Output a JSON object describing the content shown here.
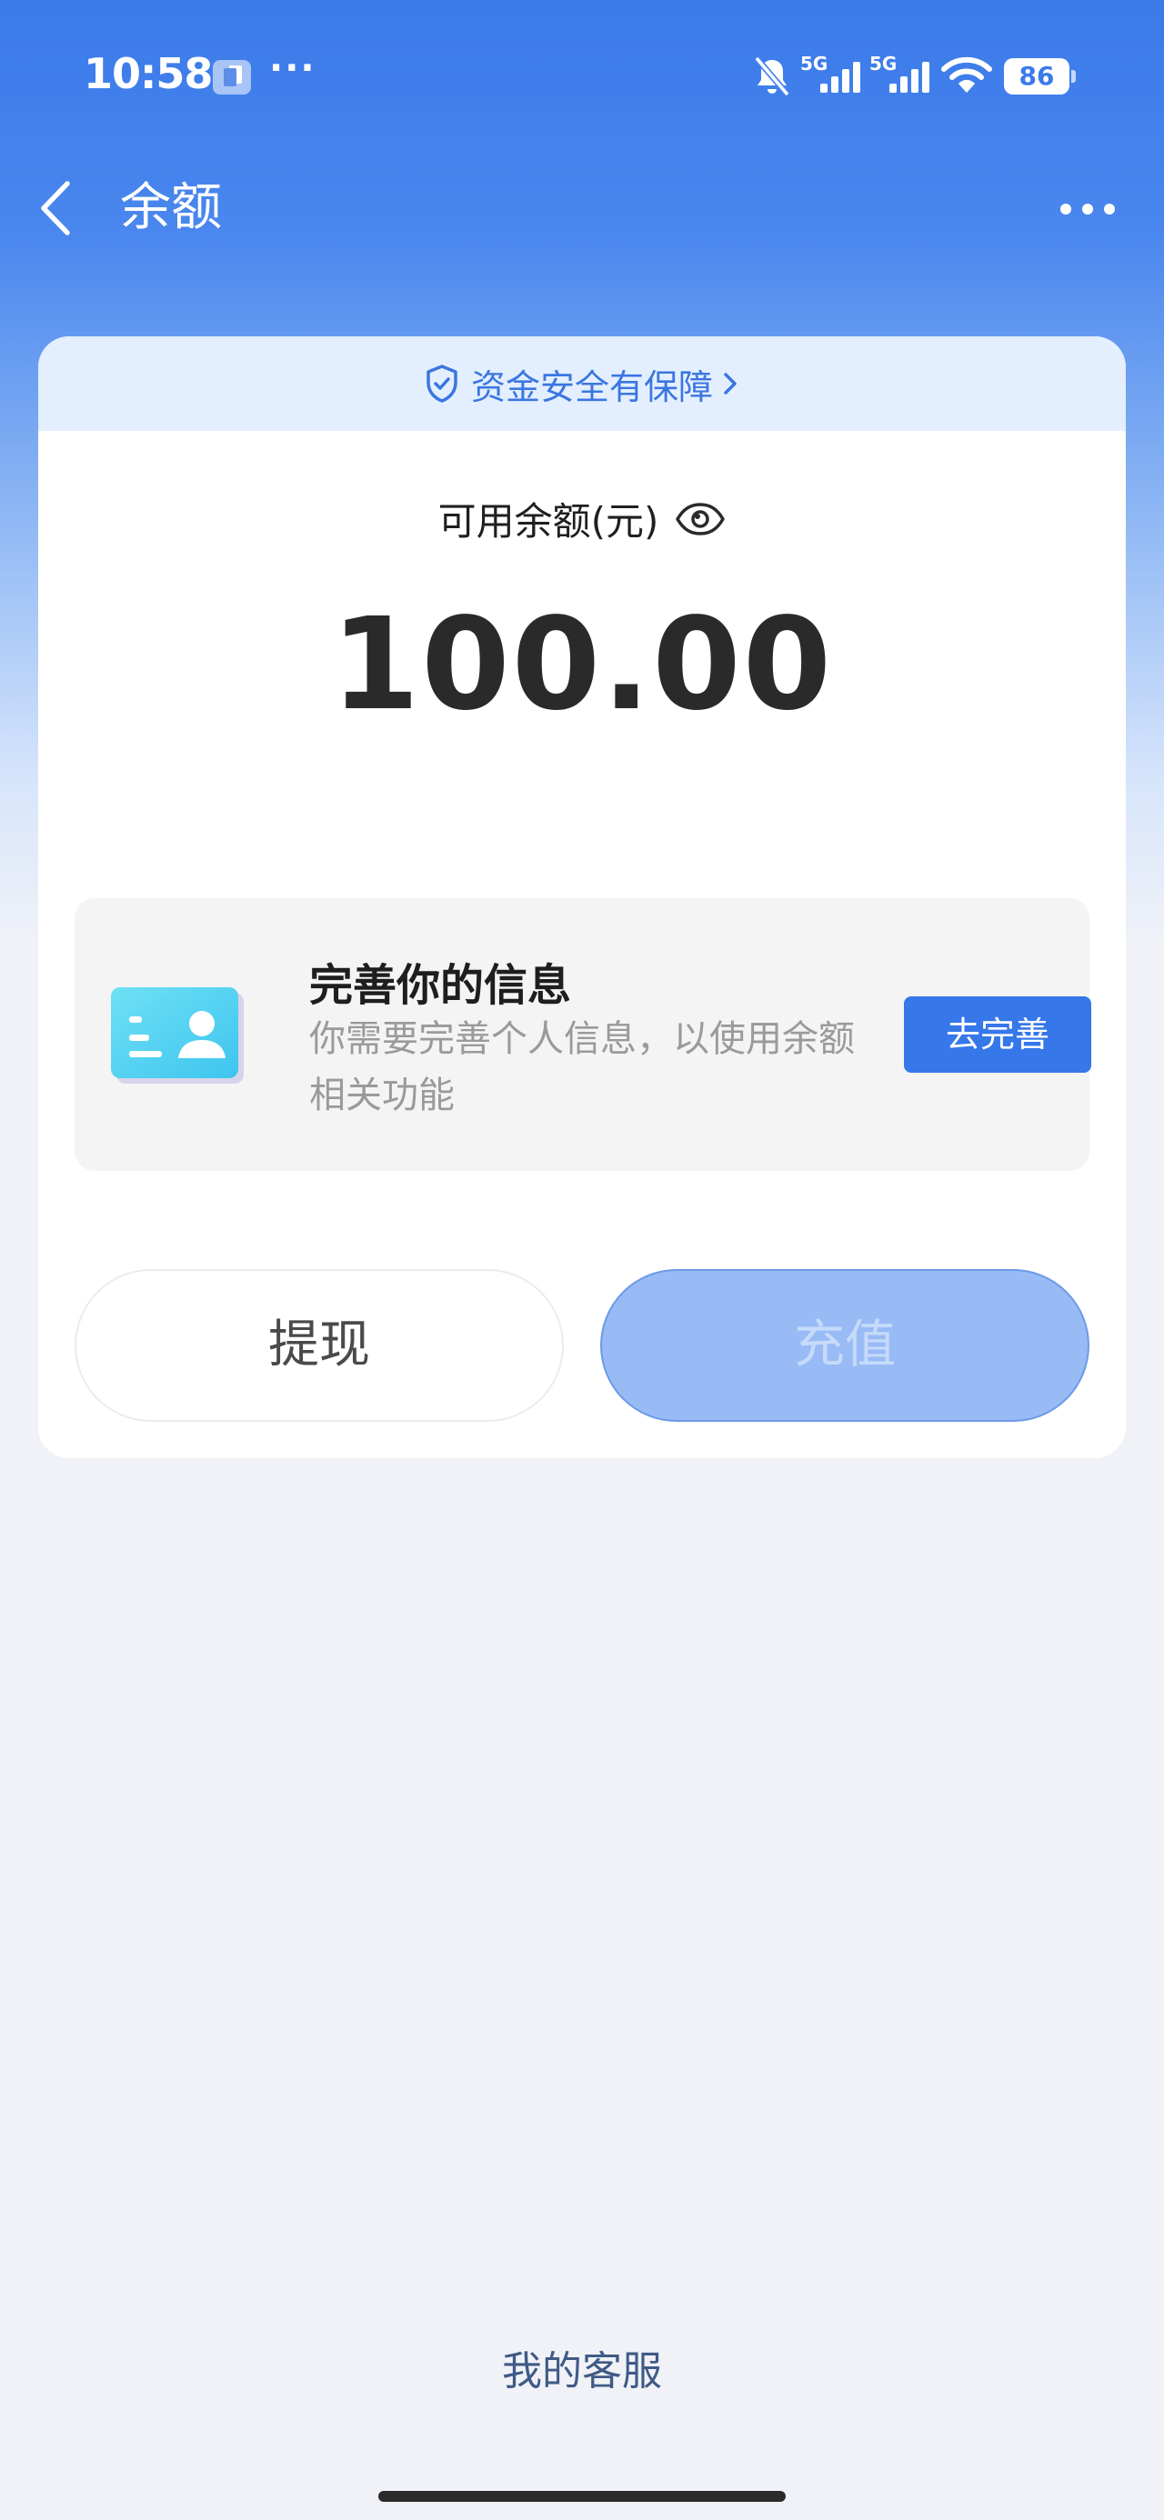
{
  "status_bar": {
    "time": "10:58",
    "dots": "···",
    "signal1_label": "5G",
    "signal2_label": "5G",
    "battery": "86"
  },
  "nav": {
    "title": "余额"
  },
  "card": {
    "safety_banner": "资金安全有保障",
    "balance_label": "可用余额(元)",
    "balance_amount": "100.00",
    "info": {
      "title": "完善你的信息",
      "description": "你需要完善个人信息，以使用余额相关功能",
      "button": "去完善"
    },
    "withdraw_label": "提现",
    "recharge_label": "充值"
  },
  "footer": {
    "service_link": "我的客服"
  },
  "colors": {
    "accent": "#3677ea",
    "banner_bg": "#e3efff",
    "recharge_disabled": "#98bbf5"
  },
  "icons": [
    "back-arrow-icon",
    "more-icon",
    "bell-off-icon",
    "wifi-icon",
    "shield-icon",
    "eye-icon",
    "id-card-icon"
  ]
}
